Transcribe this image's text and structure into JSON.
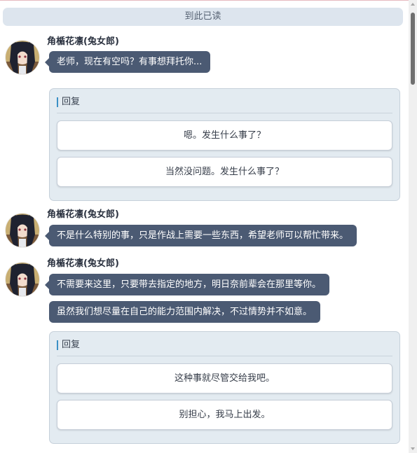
{
  "divider": {
    "label": "到此已读"
  },
  "accent_color": "#3b90c6",
  "bubble_color": "#4b5a73",
  "avatar_icon": "character-portrait",
  "messages": [
    {
      "sender": "角楯花凛(兔女郎)",
      "lines": [
        "老师，现在有空吗？有事想拜托你..."
      ]
    },
    {
      "sender": "角楯花凛(兔女郎)",
      "lines": [
        "不是什么特别的事，只是作战上需要一些东西，希望老师可以帮忙带来。"
      ]
    },
    {
      "sender": "角楯花凛(兔女郎)",
      "lines": [
        "不需要来这里，只要带去指定的地方，明日奈前辈会在那里等你。",
        "虽然我们想尽量在自己的能力范围内解决，不过情势并不如意。"
      ]
    }
  ],
  "replies": [
    {
      "label": "回复",
      "options": [
        "嗯。发生什么事了？",
        "当然没问题。发生什么事了？"
      ]
    },
    {
      "label": "回复",
      "options": [
        "这种事就尽管交给我吧。",
        "别担心，我马上出发。"
      ]
    }
  ]
}
